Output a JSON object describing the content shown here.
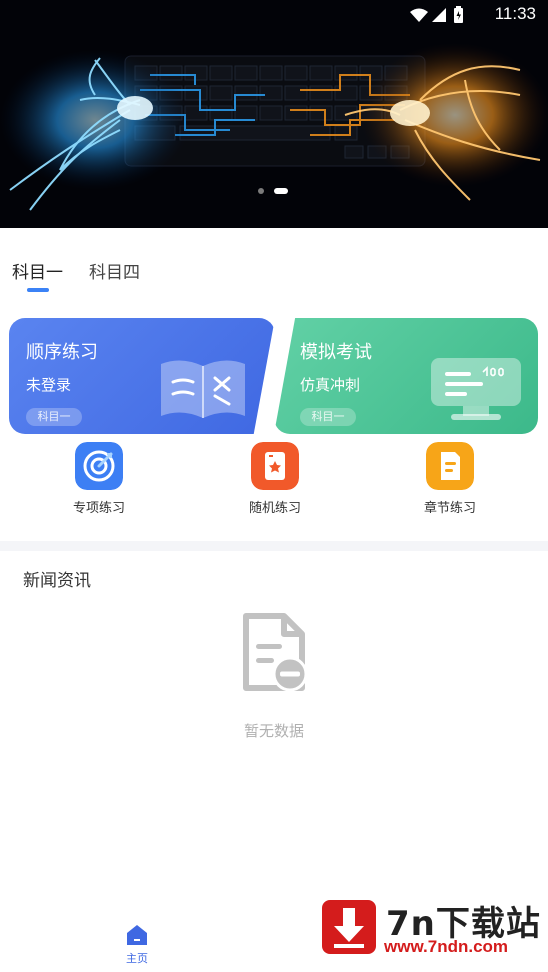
{
  "status_bar": {
    "time": "11:33"
  },
  "banner": {
    "slide_count": 2,
    "active_slide": 2
  },
  "subject_tabs": [
    {
      "label": "科目一",
      "active": true
    },
    {
      "label": "科目四",
      "active": false
    }
  ],
  "cards": [
    {
      "title": "顺序练习",
      "subtitle": "未登录",
      "tag": "科目一",
      "color": "#4a74ea"
    },
    {
      "title": "模拟考试",
      "subtitle": "仿真冲刺",
      "tag": "科目一",
      "color": "#4cc49a"
    }
  ],
  "functions": [
    {
      "label": "专项练习",
      "icon": "target-icon",
      "color": "#3b82f6"
    },
    {
      "label": "随机练习",
      "icon": "card-star-icon",
      "color": "#f15a2a"
    },
    {
      "label": "章节练习",
      "icon": "document-icon",
      "color": "#f6a417"
    }
  ],
  "news": {
    "title": "新闻资讯",
    "empty_text": "暂无数据",
    "empty_icon": "empty-document-icon"
  },
  "bottom_nav": [
    {
      "label": "主页",
      "icon": "home-icon",
      "active": true,
      "color": "#3f68e2"
    }
  ],
  "watermark": {
    "name": "7n下载站",
    "url": "www.7ndn.com",
    "color": "#d41c1c"
  }
}
